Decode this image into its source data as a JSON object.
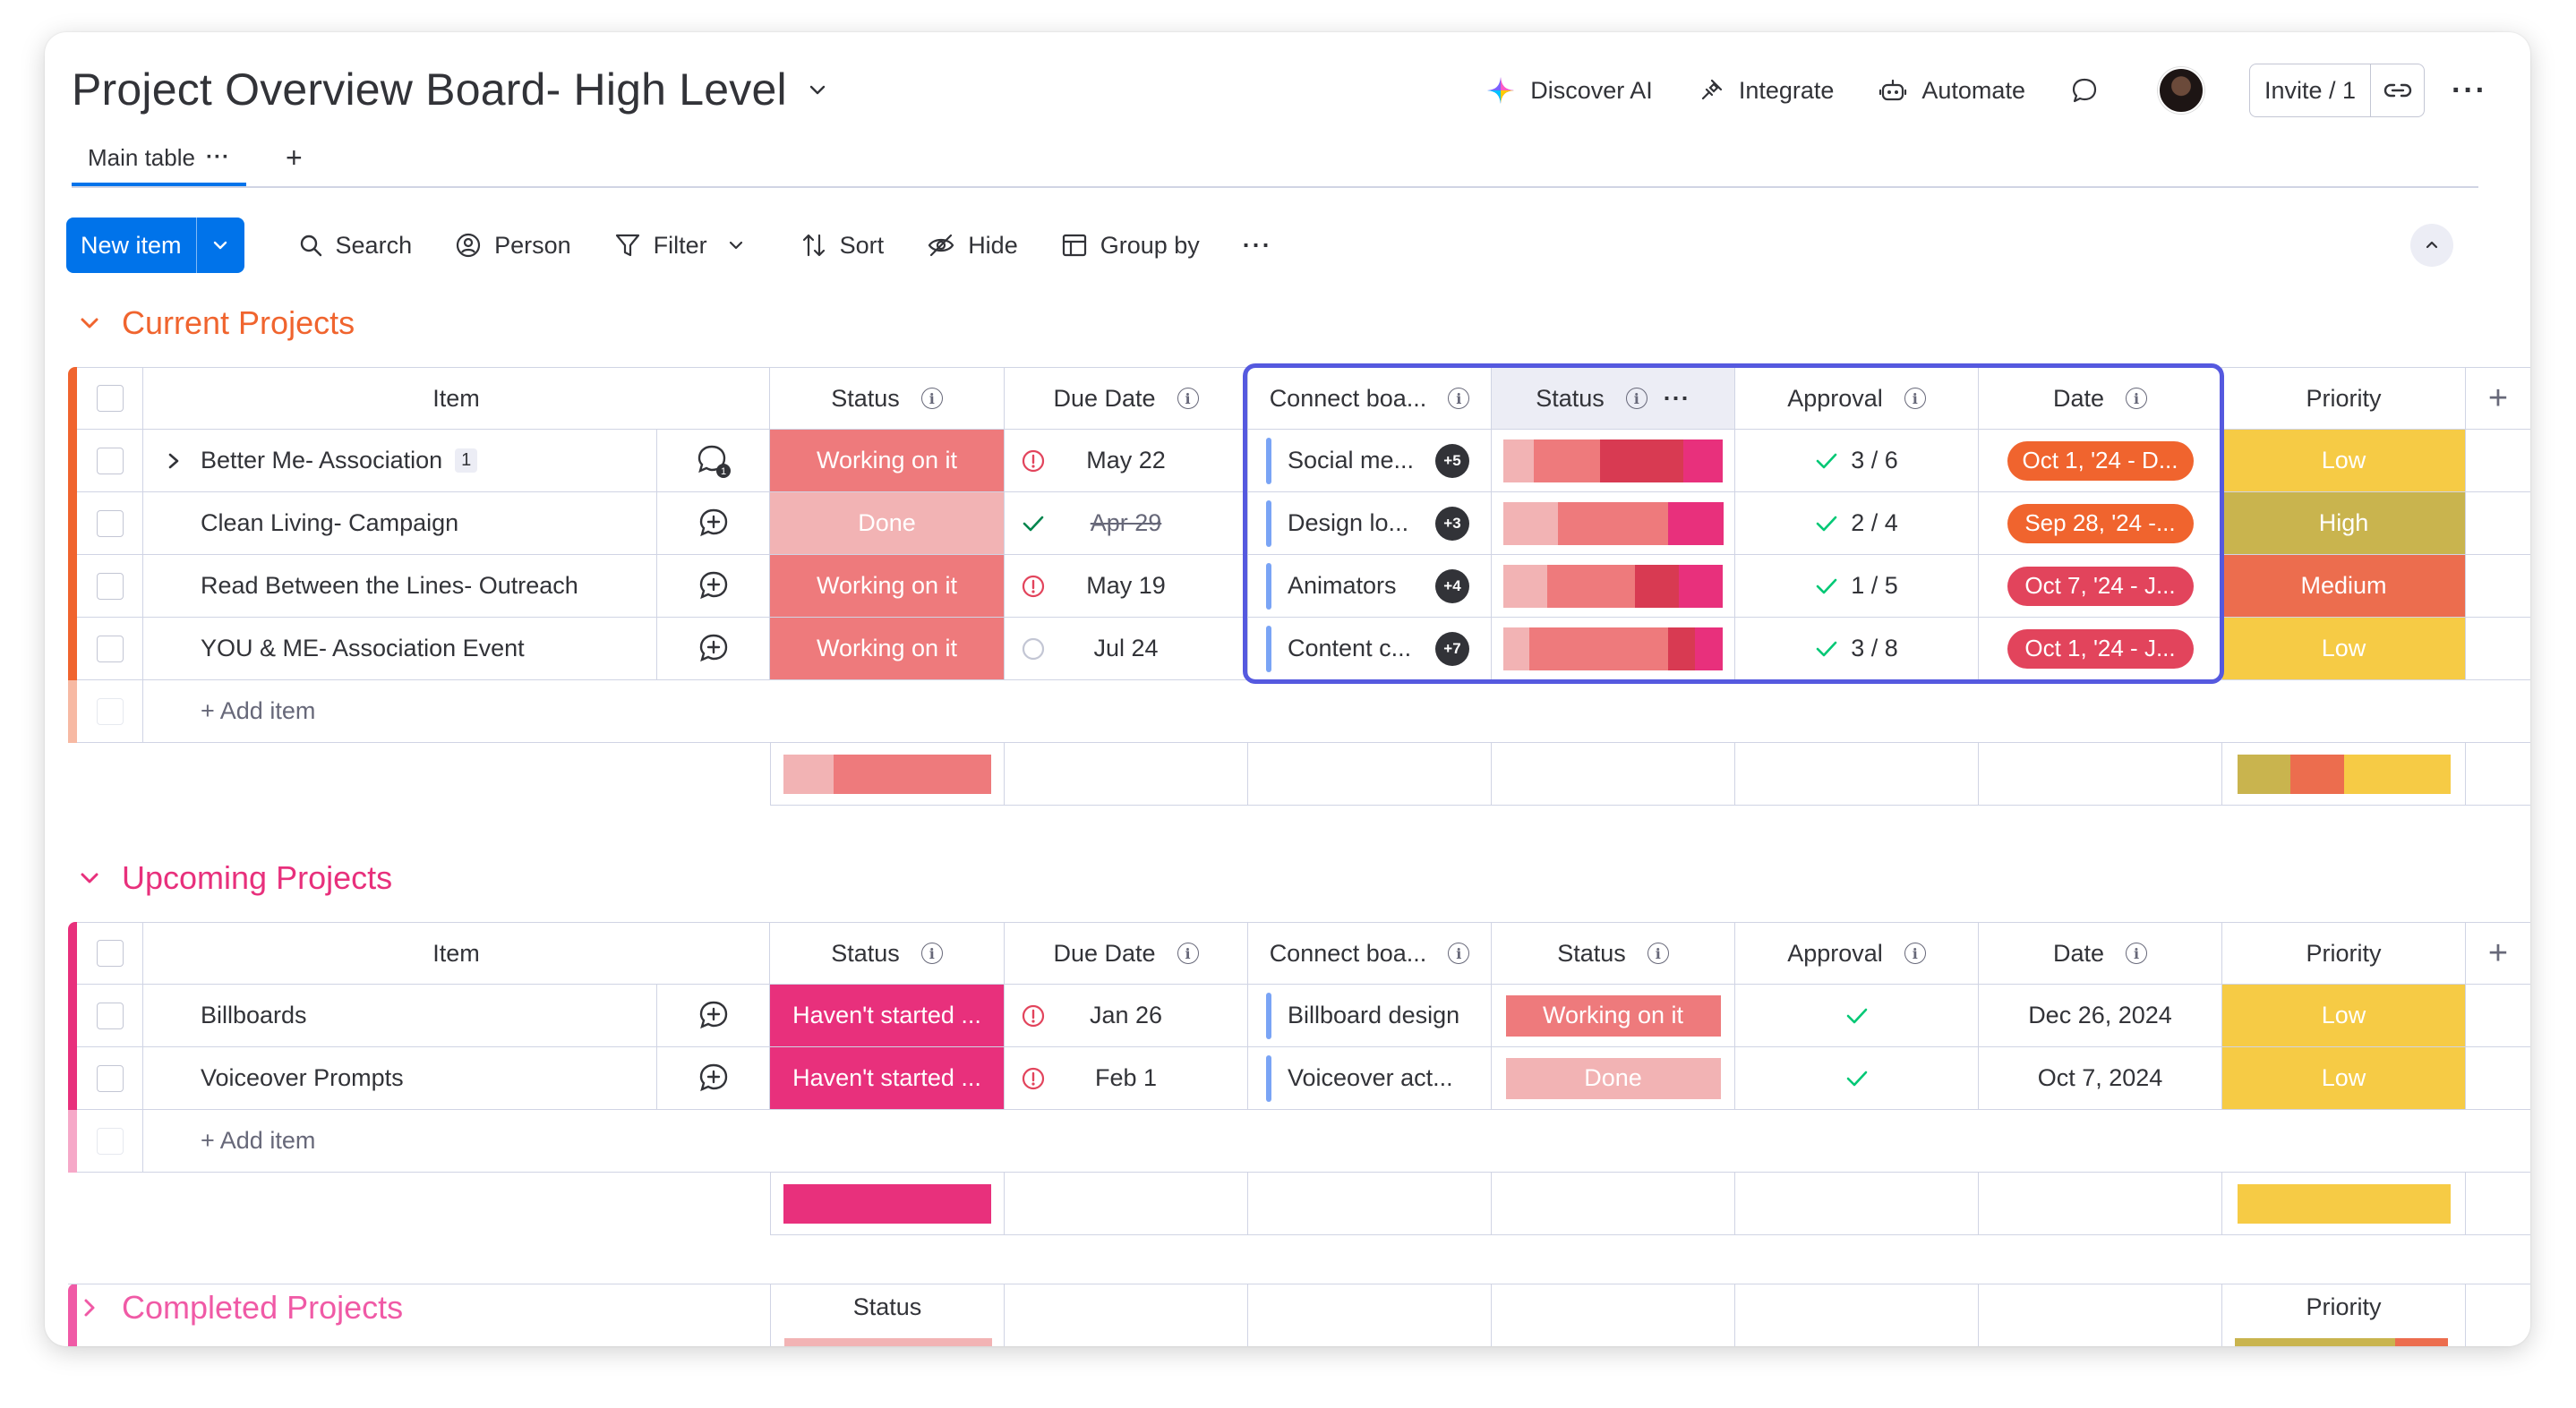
{
  "header": {
    "title": "Project Overview Board- High Level",
    "actions": {
      "discover_ai": "Discover AI",
      "integrate": "Integrate",
      "automate": "Automate",
      "invite": "Invite / 1"
    }
  },
  "tabs": [
    {
      "label": "Main table"
    }
  ],
  "toolbar": {
    "new_item": "New item",
    "search": "Search",
    "person": "Person",
    "filter": "Filter",
    "sort": "Sort",
    "hide": "Hide",
    "group_by": "Group by"
  },
  "colors": {
    "current": "#f0642e",
    "upcoming": "#e8307c",
    "completed": "#f05aa6",
    "working": "#ee7a7c",
    "done": "#f2b3b4",
    "not_started": "#e8307c",
    "low": "#f6cb45",
    "high": "#c9b44e",
    "medium": "#ec6d4e",
    "highlight": "#5559df"
  },
  "columns": {
    "item": "Item",
    "status": "Status",
    "due_date": "Due Date",
    "connect": "Connect boa...",
    "status2": "Status",
    "approval": "Approval",
    "date": "Date",
    "priority": "Priority"
  },
  "groups": {
    "current": {
      "name": "Current Projects",
      "add_item": "+ Add item",
      "rows": [
        {
          "item": "Better Me- Association",
          "subitems": "1",
          "status": "Working on it",
          "due": "May 22",
          "connect": "Social me...",
          "connect_more": "+5",
          "approval": "3 / 6",
          "date": "Oct 1, '24 - D...",
          "priority": "Low"
        },
        {
          "item": "Clean Living- Campaign",
          "status": "Done",
          "due": "Apr 29",
          "connect": "Design lo...",
          "connect_more": "+3",
          "approval": "2 / 4",
          "date": "Sep 28, '24 -...",
          "priority": "High"
        },
        {
          "item": "Read Between the Lines- Outreach",
          "status": "Working on it",
          "due": "May 19",
          "connect": "Animators",
          "connect_more": "+4",
          "approval": "1 / 5",
          "date": "Oct 7, '24 - J...",
          "priority": "Medium"
        },
        {
          "item": "YOU & ME- Association Event",
          "status": "Working on it",
          "due": "Jul 24",
          "connect": "Content c...",
          "connect_more": "+7",
          "approval": "3 / 8",
          "date": "Oct 1, '24 - J...",
          "priority": "Low"
        }
      ]
    },
    "upcoming": {
      "name": "Upcoming Projects",
      "add_item": "+ Add item",
      "rows": [
        {
          "item": "Billboards",
          "status": "Haven't started ...",
          "due": "Jan 26",
          "connect": "Billboard design",
          "status2": "Working on it",
          "date": "Dec 26, 2024",
          "priority": "Low"
        },
        {
          "item": "Voiceover Prompts",
          "status": "Haven't started ...",
          "due": "Feb 1",
          "connect": "Voiceover act...",
          "status2": "Done",
          "date": "Oct 7, 2024",
          "priority": "Low"
        }
      ]
    },
    "completed": {
      "name": "Completed Projects",
      "status": "Status",
      "priority": "Priority"
    }
  }
}
